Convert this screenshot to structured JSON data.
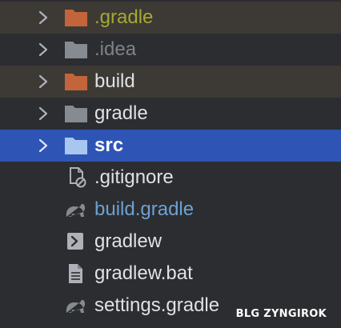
{
  "project_tree": {
    "items": [
      {
        "label": ".gradle",
        "type": "folder",
        "expandable": true,
        "icon": "folder-icon",
        "color": "#c4643a"
      },
      {
        "label": ".idea",
        "type": "folder",
        "expandable": true,
        "icon": "folder-icon",
        "color": "#868b91"
      },
      {
        "label": "build",
        "type": "folder",
        "expandable": true,
        "icon": "folder-icon",
        "color": "#c4643a"
      },
      {
        "label": "gradle",
        "type": "folder",
        "expandable": true,
        "icon": "folder-icon",
        "color": "#868b91"
      },
      {
        "label": "src",
        "type": "folder",
        "expandable": true,
        "selected": true,
        "icon": "folder-icon",
        "color": "#a9c6ef"
      },
      {
        "label": ".gitignore",
        "type": "file",
        "icon": "ignored-file-icon"
      },
      {
        "label": "build.gradle",
        "type": "file",
        "icon": "gradle-elephant-icon"
      },
      {
        "label": "gradlew",
        "type": "file",
        "icon": "shell-script-icon"
      },
      {
        "label": "gradlew.bat",
        "type": "file",
        "icon": "text-file-icon"
      },
      {
        "label": "settings.gradle",
        "type": "file",
        "icon": "gradle-elephant-icon"
      }
    ]
  },
  "watermark": "BLG ZYNGIROK",
  "colors": {
    "background": "#2b2d30",
    "excluded_row": "#3d3a36",
    "selected_row": "#2e55b6",
    "excluded_folder": "#c4643a",
    "excluded_label": "#a7a731",
    "modified_label": "#6ea1d2"
  }
}
